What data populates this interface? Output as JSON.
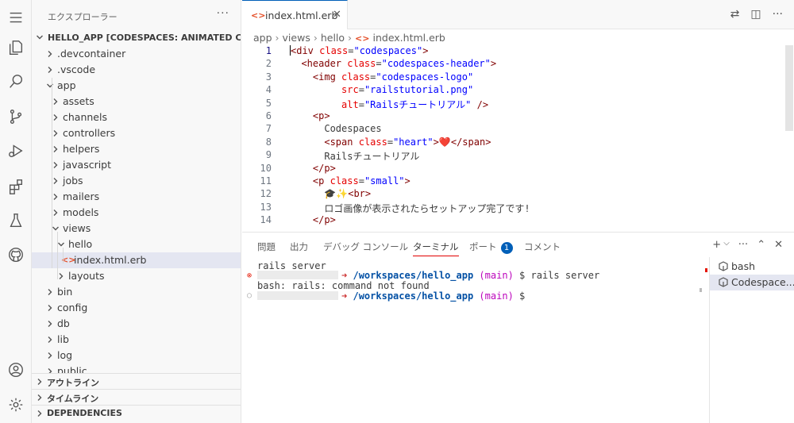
{
  "sidebar": {
    "title": "エクスプローラー",
    "more": "···",
    "project": "HELLO_APP [CODESPACES: ANIMATED COD]",
    "items": [
      {
        "label": ".devcontainer",
        "kind": "folder",
        "expanded": false
      },
      {
        "label": ".vscode",
        "kind": "folder",
        "expanded": false
      },
      {
        "label": "app",
        "kind": "folder",
        "expanded": true
      },
      {
        "label": "assets",
        "kind": "folder",
        "expanded": false
      },
      {
        "label": "channels",
        "kind": "folder",
        "expanded": false
      },
      {
        "label": "controllers",
        "kind": "folder",
        "expanded": false
      },
      {
        "label": "helpers",
        "kind": "folder",
        "expanded": false
      },
      {
        "label": "javascript",
        "kind": "folder",
        "expanded": false
      },
      {
        "label": "jobs",
        "kind": "folder",
        "expanded": false
      },
      {
        "label": "mailers",
        "kind": "folder",
        "expanded": false
      },
      {
        "label": "models",
        "kind": "folder",
        "expanded": false
      },
      {
        "label": "views",
        "kind": "folder",
        "expanded": true
      },
      {
        "label": "hello",
        "kind": "folder",
        "expanded": true
      },
      {
        "label": "index.html.erb",
        "kind": "file",
        "selected": true
      },
      {
        "label": "layouts",
        "kind": "folder",
        "expanded": false
      },
      {
        "label": "bin",
        "kind": "folder",
        "expanded": false
      },
      {
        "label": "config",
        "kind": "folder",
        "expanded": false
      },
      {
        "label": "db",
        "kind": "folder",
        "expanded": false
      },
      {
        "label": "lib",
        "kind": "folder",
        "expanded": false
      },
      {
        "label": "log",
        "kind": "folder",
        "expanded": false
      },
      {
        "label": "public",
        "kind": "folder",
        "expanded": false
      }
    ],
    "sections": [
      "アウトライン",
      "タイムライン",
      "DEPENDENCIES"
    ]
  },
  "editor": {
    "tab_label": "index.html.erb",
    "file_icon": "<>",
    "close": "✕",
    "breadcrumb": [
      "app",
      "views",
      "hello",
      "index.html.erb"
    ],
    "active_line": 1,
    "lines": [
      [
        [
          "tag",
          "<div "
        ],
        [
          "attr",
          "class"
        ],
        [
          "txt",
          "="
        ],
        [
          "str",
          "\"codespaces\""
        ],
        [
          "tag",
          ">"
        ]
      ],
      [
        [
          "txt",
          "  "
        ],
        [
          "tag",
          "<header "
        ],
        [
          "attr",
          "class"
        ],
        [
          "txt",
          "="
        ],
        [
          "str",
          "\"codespaces-header\""
        ],
        [
          "tag",
          ">"
        ]
      ],
      [
        [
          "txt",
          "    "
        ],
        [
          "tag",
          "<img "
        ],
        [
          "attr",
          "class"
        ],
        [
          "txt",
          "="
        ],
        [
          "str",
          "\"codespaces-logo\""
        ]
      ],
      [
        [
          "txt",
          "         "
        ],
        [
          "attr",
          "src"
        ],
        [
          "txt",
          "="
        ],
        [
          "str",
          "\"railstutorial.png\""
        ]
      ],
      [
        [
          "txt",
          "         "
        ],
        [
          "attr",
          "alt"
        ],
        [
          "txt",
          "="
        ],
        [
          "str",
          "\"Railsチュートリアル\""
        ],
        [
          "tag",
          " />"
        ]
      ],
      [
        [
          "txt",
          "    "
        ],
        [
          "tag",
          "<p>"
        ]
      ],
      [
        [
          "txt",
          "      Codespaces"
        ]
      ],
      [
        [
          "txt",
          "      "
        ],
        [
          "tag",
          "<span "
        ],
        [
          "attr",
          "class"
        ],
        [
          "txt",
          "="
        ],
        [
          "str",
          "\"heart\""
        ],
        [
          "tag",
          ">"
        ],
        [
          "txt",
          "❤️"
        ],
        [
          "tag",
          "</span>"
        ]
      ],
      [
        [
          "txt",
          "      Railsチュートリアル"
        ]
      ],
      [
        [
          "txt",
          "    "
        ],
        [
          "tag",
          "</p>"
        ]
      ],
      [
        [
          "txt",
          "    "
        ],
        [
          "tag",
          "<p "
        ],
        [
          "attr",
          "class"
        ],
        [
          "txt",
          "="
        ],
        [
          "str",
          "\"small\""
        ],
        [
          "tag",
          ">"
        ]
      ],
      [
        [
          "txt",
          "      🎓✨"
        ],
        [
          "tag",
          "<br>"
        ]
      ],
      [
        [
          "txt",
          "      ロゴ画像が表示されたらセットアップ完了です!"
        ]
      ],
      [
        [
          "txt",
          "    "
        ],
        [
          "tag",
          "</p>"
        ]
      ]
    ]
  },
  "panel": {
    "tabs": [
      "問題",
      "出力",
      "デバッグ コンソール",
      "ターミナル",
      "ポート",
      "コメント"
    ],
    "active_tab": "ターミナル",
    "ports_badge": "1",
    "actions": [
      "+",
      "⌵",
      "···",
      "⌃",
      "✕"
    ],
    "terminal": {
      "line1": "rails server",
      "arrow": "➜",
      "path": "/workspaces/hello_app",
      "branch_open": "(",
      "branch": "main",
      "branch_close": ")",
      "prompt": "$",
      "cmd": "rails server",
      "error": "bash: rails: command not found"
    },
    "terminal_list": [
      "bash",
      "Codespace..."
    ]
  },
  "colors": {
    "accent": "#005fb8",
    "error": "#e51400",
    "erb_icon": "#e44d26"
  }
}
